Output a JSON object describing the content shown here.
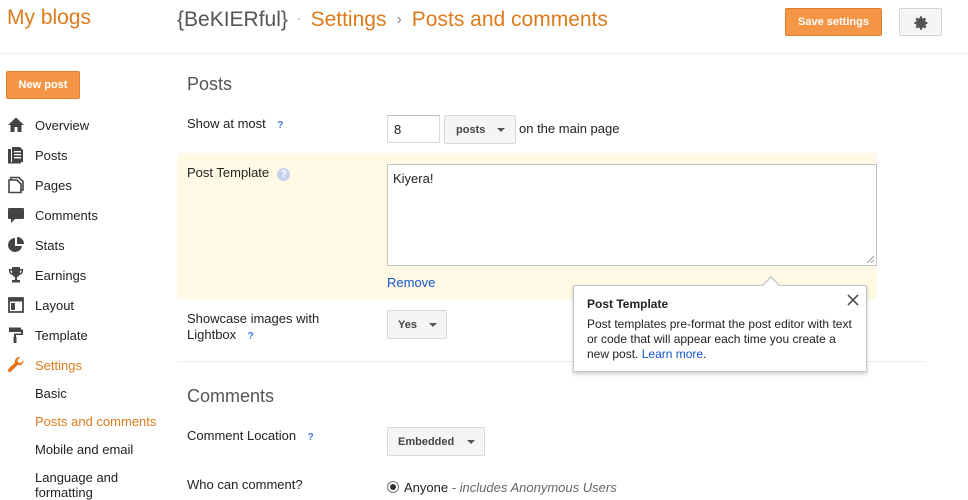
{
  "header": {
    "brand": "My blogs",
    "blog_name": "{BeKIERful}",
    "dot": "·",
    "crumb_settings": "Settings",
    "arrow": "›",
    "crumb_page": "Posts and comments",
    "save_label": "Save settings",
    "accent_color": "#f59646"
  },
  "sidebar": {
    "new_post_label": "New post",
    "items": [
      {
        "label": "Overview",
        "icon": "home-icon"
      },
      {
        "label": "Posts",
        "icon": "posts-icon"
      },
      {
        "label": "Pages",
        "icon": "pages-icon"
      },
      {
        "label": "Comments",
        "icon": "comments-icon"
      },
      {
        "label": "Stats",
        "icon": "stats-icon"
      },
      {
        "label": "Earnings",
        "icon": "trophy-icon"
      },
      {
        "label": "Layout",
        "icon": "layout-icon"
      },
      {
        "label": "Template",
        "icon": "paint-roller-icon"
      },
      {
        "label": "Settings",
        "icon": "wrench-icon",
        "active": true
      }
    ],
    "sub_items": [
      {
        "label": "Basic"
      },
      {
        "label": "Posts and comments",
        "active": true
      },
      {
        "label": "Mobile and email"
      },
      {
        "label": "Language and formatting"
      }
    ]
  },
  "posts_section": {
    "title": "Posts",
    "show_at_most_label": "Show at most",
    "show_at_most_value": "8",
    "unit_dropdown": "posts",
    "after_text": "on the main page",
    "post_template_label": "Post Template",
    "post_template_value": "Kiyera!",
    "remove_label": "Remove",
    "lightbox_label": "Showcase images with Lightbox",
    "lightbox_value": "Yes"
  },
  "tooltip": {
    "title": "Post Template",
    "body": "Post templates pre-format the post editor with text or code that will appear each time you create a new post.",
    "link": "Learn more",
    "period": "."
  },
  "comments_section": {
    "title": "Comments",
    "location_label": "Comment Location",
    "location_value": "Embedded",
    "who_label": "Who can comment?",
    "who_option": "Anyone",
    "who_option_note": "- includes Anonymous Users"
  }
}
